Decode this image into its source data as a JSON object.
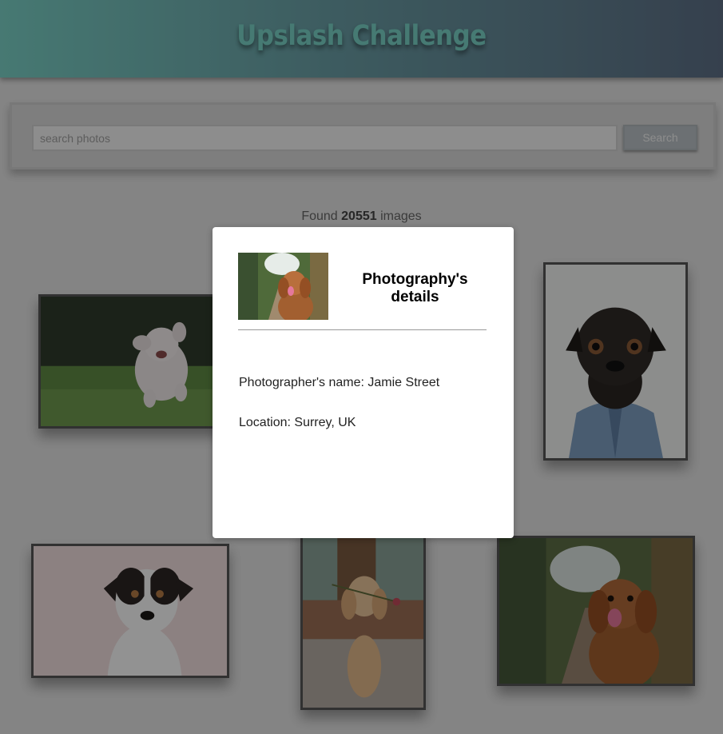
{
  "header": {
    "title": "Upslash Challenge"
  },
  "search": {
    "placeholder": "search photos",
    "button_label": "Search"
  },
  "results": {
    "prefix": "Found",
    "count": "20551",
    "suffix": "images"
  },
  "photos": [
    {
      "subject": "white fluffy dog running on grass"
    },
    {
      "subject": "pug wearing denim jacket"
    },
    {
      "subject": "jack russell terrier portrait"
    },
    {
      "subject": "golden retriever holding a rose"
    },
    {
      "subject": "brown spaniel dog on forest path"
    }
  ],
  "modal": {
    "title": "Photography's details",
    "photographer_label": "Photographer's name:",
    "photographer_value": "Jamie Street",
    "location_label": "Location:",
    "location_value": "Surrey, UK"
  },
  "colors": {
    "header_accent": "#79d3c6",
    "overlay": "rgba(0,0,0,0.42)"
  }
}
